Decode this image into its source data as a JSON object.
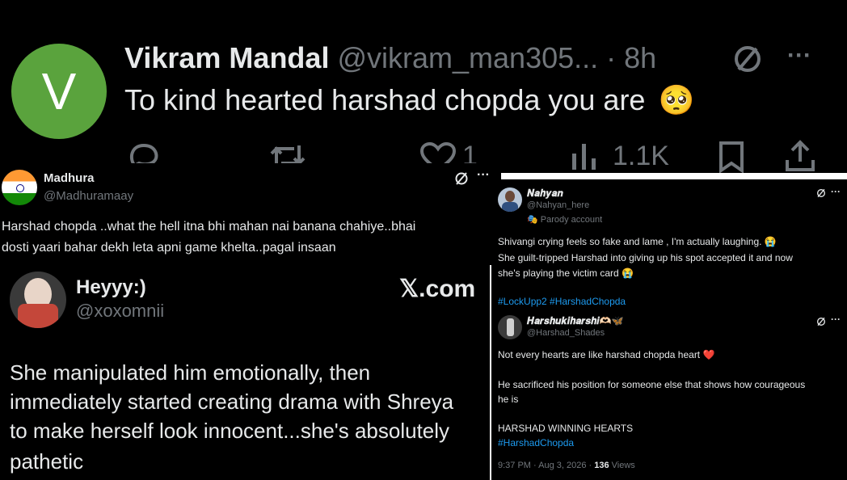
{
  "tweet_top": {
    "avatar_letter": "V",
    "avatar_color": "#5aa33d",
    "name": "Vikram Mandal",
    "handle": "@vikram_man305...",
    "time": "· 8h",
    "text": "To kind hearted harshad chopda you are",
    "emoji": "🥺",
    "actions": {
      "reply": "",
      "retweet": "",
      "likes": "1",
      "views": "1.1K"
    }
  },
  "tweet_madhura": {
    "name": "Madhura",
    "handle": "@Madhuramaay",
    "line1": "Harshad chopda ..what the hell itna bhi mahan nai banana chahiye..bhai",
    "line2": "dosti yaari bahar dekh leta apni game khelta..pagal insaan",
    "flag_colors": [
      "#ff9933",
      "#ffffff",
      "#138808"
    ]
  },
  "tweet_heyyy": {
    "name": "Heyyy:)",
    "handle": "@xoxomnii",
    "brand": "𝕏.com",
    "lines": [
      "She manipulated him emotionally, then",
      "immediately started creating drama with Shreya",
      "to make herself look innocent...she's absolutely",
      "pathetic"
    ]
  },
  "tweet_nahyan": {
    "name": "𝑵𝒂𝒉𝒚𝒂𝒏",
    "handle": "@Nahyan_here",
    "parody": "Parody account",
    "line1": "Shivangi crying feels so fake and lame , I'm actually laughing. 😭",
    "line2": "She guilt-tripped Harshad into giving up his spot accepted it and now",
    "line3": "she's playing the victim card 😭",
    "hashtags": "#LockUpp2 #HarshadChopda"
  },
  "tweet_harshu": {
    "name": "𝑯𝒂𝒓𝒔𝒉𝒖𝒌𝒊𝒉𝒂𝒓𝒔𝒉𝒊🫶🏻🦋",
    "handle": "@Harshad_Shades",
    "line1": "Not every hearts are like harshad chopda heart ❤️",
    "line2": "He sacrificed his position for someone else that shows how courageous",
    "line3": "he is",
    "line4": "HARSHAD WINNING HEARTS",
    "hashtag": "#HarshadChopda",
    "meta_time": "9:37 PM · Aug 3, 2026 · ",
    "views_count": "136",
    "views_label": " Views"
  },
  "icons": {
    "more": "···"
  }
}
